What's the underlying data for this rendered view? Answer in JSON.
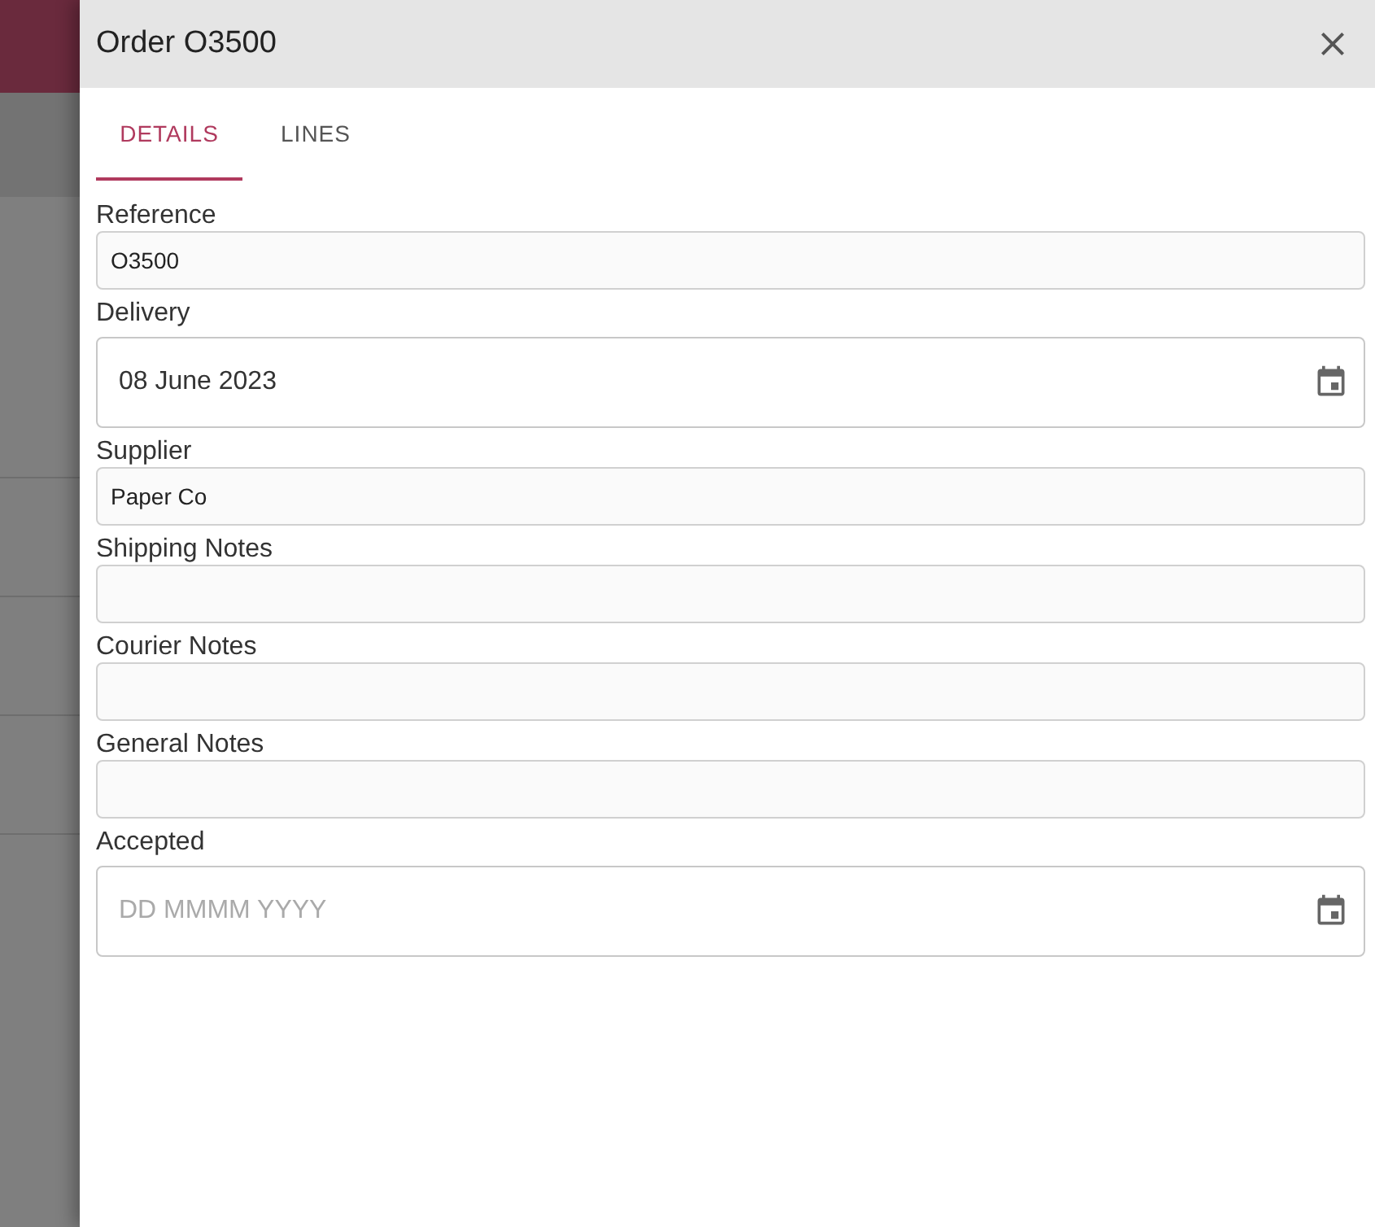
{
  "drawer": {
    "title": "Order O3500"
  },
  "tabs": [
    {
      "label": "DETAILS",
      "selected": true
    },
    {
      "label": "LINES",
      "selected": false
    }
  ],
  "fields": [
    {
      "kind": "text",
      "label": "Reference",
      "value": "O3500"
    },
    {
      "kind": "date",
      "label": "Delivery",
      "value": "08 June 2023"
    },
    {
      "kind": "text",
      "label": "Supplier",
      "value": "Paper Co"
    },
    {
      "kind": "text",
      "label": "Shipping Notes"
    },
    {
      "kind": "text",
      "label": "Courier Notes"
    },
    {
      "kind": "text",
      "label": "General Notes"
    },
    {
      "kind": "date",
      "label": "Accepted",
      "placeholder": "DD MMMM YYYY"
    }
  ]
}
